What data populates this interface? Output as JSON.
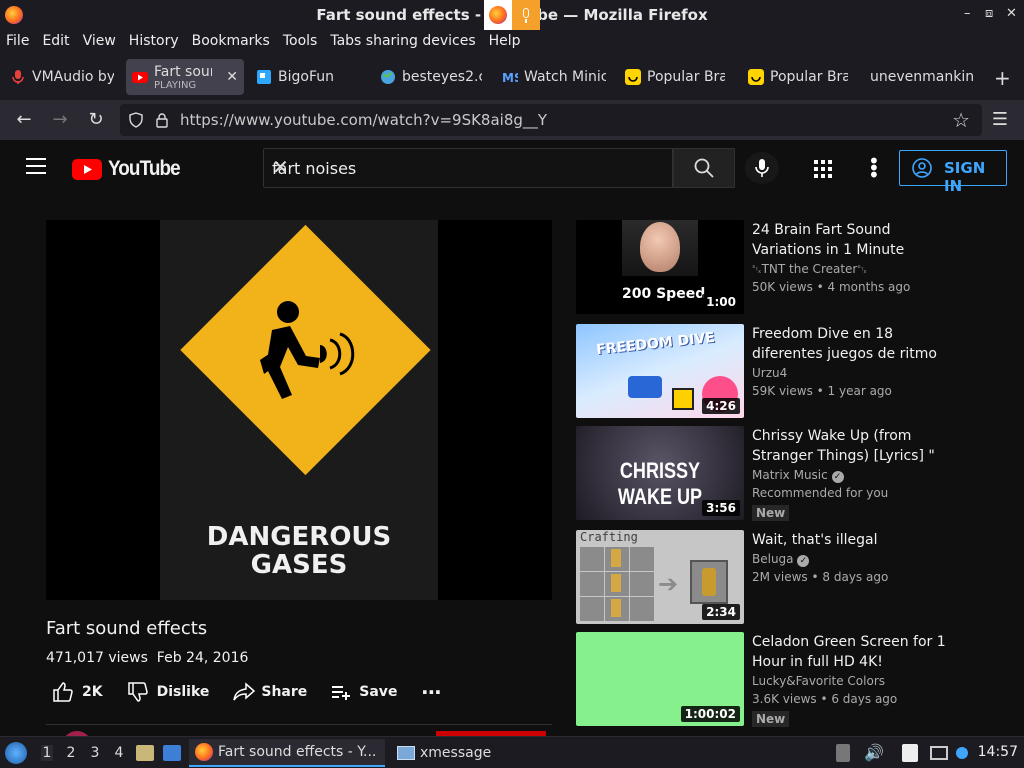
{
  "window": {
    "title": "Fart sound effects - YouTube — Mozilla Firefox",
    "title_visible_left": "Fart sound effects -",
    "title_visible_right": "be — Mozilla Firefox"
  },
  "menubar": [
    "File",
    "Edit",
    "View",
    "History",
    "Bookmarks",
    "Tools",
    "Tabs sharing devices",
    "Help"
  ],
  "tabs": [
    {
      "label": "VMAudio by",
      "icon": "mic-icon",
      "color": "#e8413b"
    },
    {
      "label": "Fart soun",
      "sub": "PLAYING",
      "icon": "youtube-icon",
      "color": "#ff0000",
      "active": true
    },
    {
      "label": "BigoFun",
      "icon": "bigofun-icon",
      "color": "#2ea8ff"
    },
    {
      "label": "besteyes2.c",
      "icon": "globe-icon",
      "color": "#4aa3df"
    },
    {
      "label": "Watch Minic",
      "icon": "ms-icon",
      "color": "#5aa0ff"
    },
    {
      "label": "Popular Bra",
      "icon": "smile-icon",
      "color": "#ffd400"
    },
    {
      "label": "Popular Bra",
      "icon": "smile-icon",
      "color": "#ffd400"
    },
    {
      "label": "unevenmankin",
      "icon": "",
      "color": ""
    }
  ],
  "navbar": {
    "url": "https://www.youtube.com/watch?v=9SK8ai8g__Y"
  },
  "youtube": {
    "logo_text": "YouTube",
    "search_value": "fart noises",
    "signin": "SIGN IN",
    "player_caption": "DANGEROUS\nGASES",
    "video_title": "Fart sound effects",
    "views": "471,017 views",
    "date": "Feb 24, 2016",
    "likes": "2K",
    "dislike": "Dislike",
    "share": "Share",
    "save": "Save"
  },
  "recommendations": [
    {
      "title": "24 Brain Fart Sound Variations in 1 Minute",
      "channel": "␂TNT the Creater␂",
      "views": "50K views • 4 months ago",
      "duration": "1:00",
      "thumb": "200 Speed",
      "new": false
    },
    {
      "title": "Freedom Dive en 18 diferentes juegos de ritmo",
      "channel": "Urzu4",
      "views": "59K views • 1 year ago",
      "duration": "4:26",
      "thumb": "FREEDOM DIVE",
      "new": false
    },
    {
      "title": "Chrissy Wake Up (from Stranger Things) [Lyrics] \" chrissy wake…",
      "channel": "Matrix Music",
      "views": "Recommended for you",
      "duration": "3:56",
      "thumb": "CHRISSY WAKE UP",
      "new": true
    },
    {
      "title": "Wait, that's illegal",
      "channel": "Beluga",
      "views": "2M views • 8 days ago",
      "duration": "2:34",
      "thumb": "Crafting",
      "new": false
    },
    {
      "title": "Celadon Green Screen for 1 Hour in full HD 4K!",
      "channel": "Lucky&Favorite Colors",
      "views": "3.6K views • 6 days ago",
      "duration": "1:00:02",
      "thumb": "",
      "new": true
    }
  ],
  "taskbar": {
    "workspaces": [
      "1",
      "2",
      "3",
      "4"
    ],
    "tasks": [
      "Fart sound effects - Y...",
      "xmessage"
    ],
    "clock": "14:57"
  },
  "colors": {
    "accent": "#3ea6ff",
    "youtube_red": "#ff0000",
    "sign_yellow": "#f2b21a",
    "green_screen": "#86f08d"
  }
}
